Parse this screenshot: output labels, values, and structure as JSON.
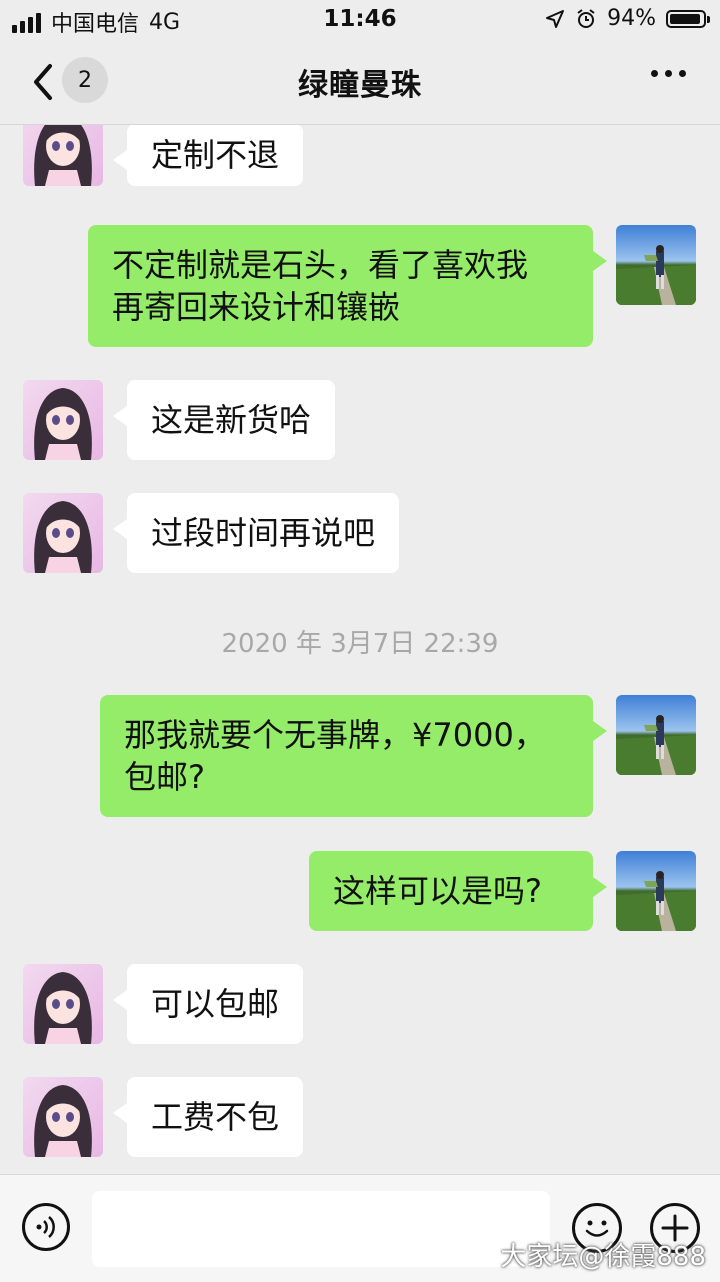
{
  "status_bar": {
    "carrier": "中国电信",
    "network": "4G",
    "time": "11:46",
    "battery": "94%",
    "battery_level": 0.94
  },
  "nav": {
    "unread_count": "2",
    "title": "绿瞳曼珠"
  },
  "messages": [
    {
      "side": "left",
      "text": "定制不退"
    },
    {
      "side": "right",
      "line1": "不定制就是石头，看了喜欢我",
      "line2": "再寄回来设计和镶嵌"
    },
    {
      "side": "left",
      "text": "这是新货哈"
    },
    {
      "side": "left",
      "text": "过段时间再说吧"
    },
    {
      "side": "right",
      "line1": "那我就要个无事牌，¥7000，",
      "line2": "包邮?"
    },
    {
      "side": "right",
      "text": "这样可以是吗?"
    },
    {
      "side": "left",
      "text": "可以包邮"
    },
    {
      "side": "left",
      "text": "工费不包"
    }
  ],
  "timestamp": "2020 年 3月7日 22:39",
  "input": {
    "placeholder": ""
  },
  "watermark": "大家坛@徐霞888",
  "colors": {
    "background": "#ededed",
    "green_bubble": "#95ec69",
    "white_bubble": "#ffffff"
  }
}
